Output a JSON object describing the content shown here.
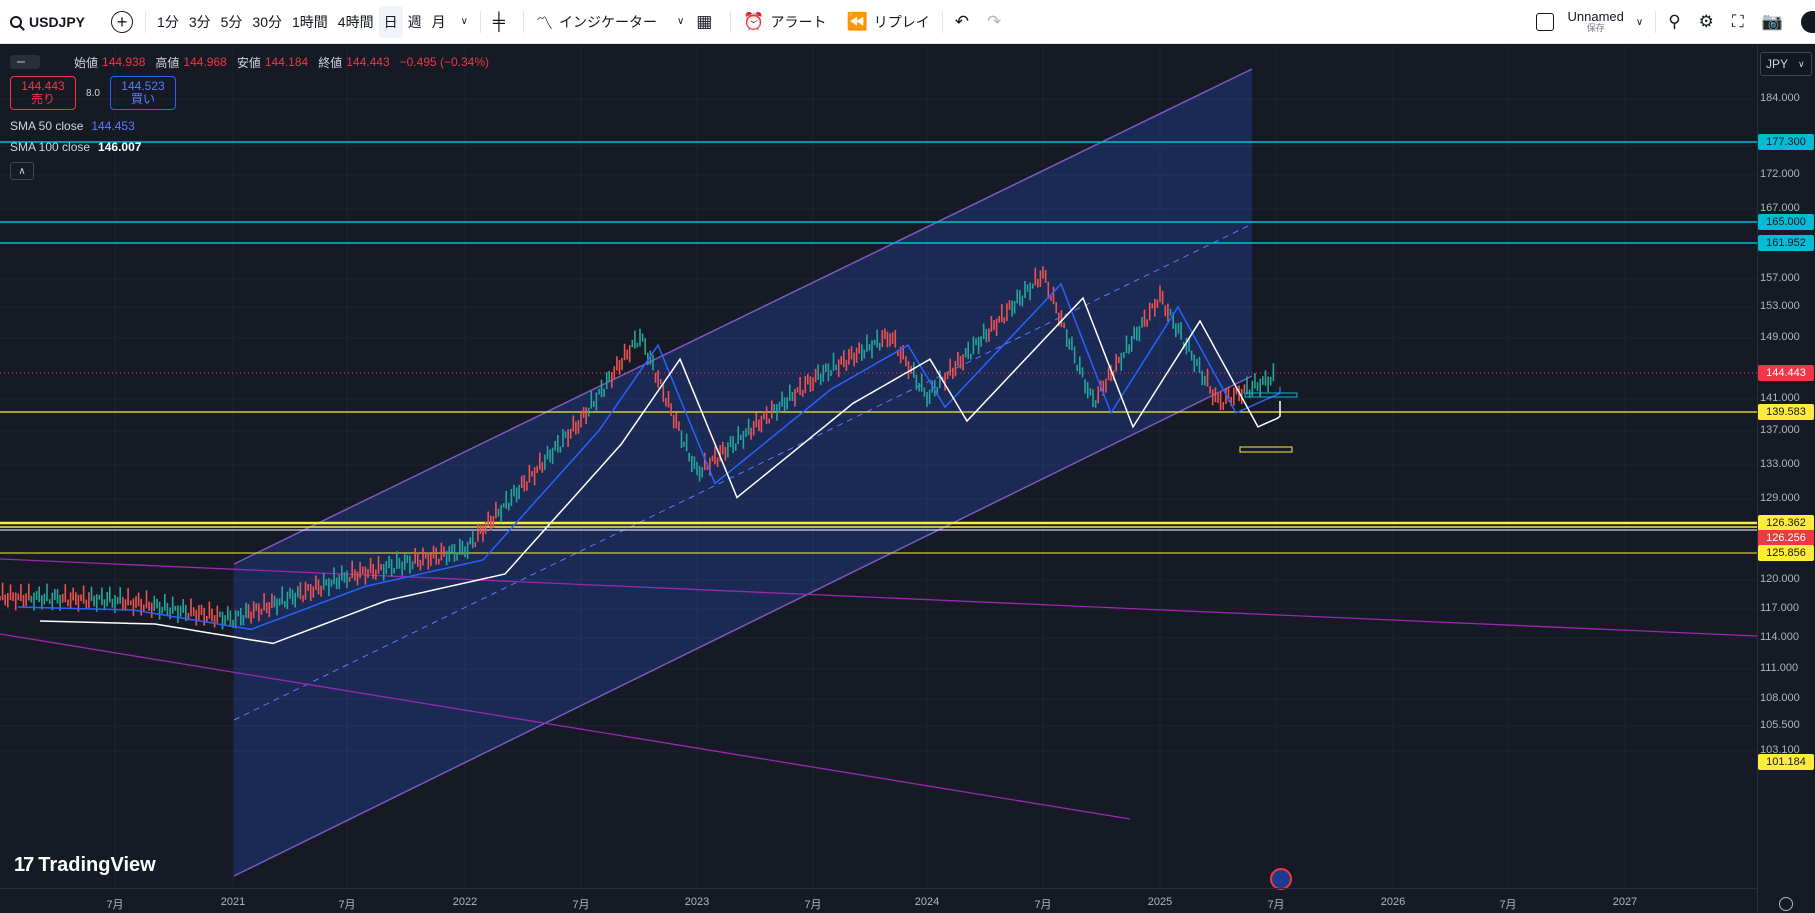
{
  "toolbar": {
    "symbol": "USDJPY",
    "intervals": [
      "1分",
      "3分",
      "5分",
      "30分",
      "1時間",
      "4時間",
      "日",
      "週",
      "月"
    ],
    "active_interval": "日",
    "indicators_label": "インジケーター",
    "alert_label": "アラート",
    "replay_label": "リプレイ",
    "layout_name": "Unnamed",
    "layout_status": "保存"
  },
  "legend": {
    "open_label": "始値",
    "open": "144.938",
    "high_label": "高値",
    "high": "144.968",
    "low_label": "安値",
    "low": "144.184",
    "close_label": "終値",
    "close": "144.443",
    "change": "−0.495 (−0.34%)",
    "sell_price": "144.443",
    "sell_label": "売り",
    "spread": "8.0",
    "buy_price": "144.523",
    "buy_label": "買い",
    "sma50_label": "SMA 50 close",
    "sma50_value": "144.453",
    "sma100_label": "SMA 100 close",
    "sma100_value": "146.007"
  },
  "price_scale": {
    "currency": "JPY",
    "ticks": [
      "184.000",
      "176.000",
      "172.000",
      "167.000",
      "157.000",
      "153.000",
      "149.000",
      "141.000",
      "137.000",
      "133.000",
      "129.000",
      "120.000",
      "117.000",
      "114.000",
      "111.000",
      "108.000",
      "105.500",
      "103.100"
    ],
    "labels": [
      {
        "text": "177.300",
        "color": "#00bcd4",
        "fg": "#131722"
      },
      {
        "text": "165.000",
        "color": "#00bcd4",
        "fg": "#131722"
      },
      {
        "text": "161.952",
        "color": "#00bcd4",
        "fg": "#131722"
      },
      {
        "text": "144.443",
        "color": "#f23645",
        "fg": "#ffffff"
      },
      {
        "text": "139.583",
        "color": "#ffeb3b",
        "fg": "#131722"
      },
      {
        "text": "126.362",
        "color": "#ffeb3b",
        "fg": "#131722"
      },
      {
        "text": "126.256",
        "color": "#f23645",
        "fg": "#ffffff"
      },
      {
        "text": "125.856",
        "color": "#ffeb3b",
        "fg": "#131722"
      },
      {
        "text": "101.184",
        "color": "#ffeb3b",
        "fg": "#131722"
      }
    ]
  },
  "time_axis": {
    "labels": [
      "7月",
      "2021",
      "7月",
      "2022",
      "7月",
      "2023",
      "7月",
      "2024",
      "7月",
      "2025",
      "7月",
      "2026",
      "7月",
      "2027"
    ]
  },
  "branding": {
    "logo_text": "TradingView"
  },
  "chart_data": {
    "type": "line",
    "x": [
      "2020-07",
      "2021-01",
      "2021-07",
      "2022-01",
      "2022-07",
      "2022-10",
      "2023-01",
      "2023-07",
      "2023-11",
      "2024-01",
      "2024-07",
      "2024-09",
      "2025-01",
      "2025-04",
      "2025-06"
    ],
    "series": [
      {
        "values": [
          106.5,
          103.2,
          110.5,
          115.0,
          137.0,
          151.5,
          128.0,
          144.0,
          151.5,
          141.0,
          161.9,
          140.0,
          158.0,
          140.0,
          144.4
        ]
      }
    ],
    "ylim": [
      101.184,
      188.0
    ]
  }
}
